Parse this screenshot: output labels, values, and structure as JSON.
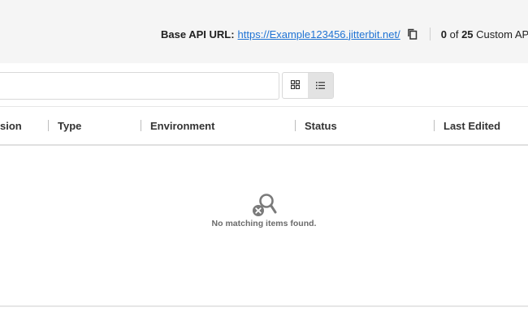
{
  "api": {
    "label": "Base API URL:",
    "url": "https://Example123456.jitterbit.net/",
    "copy_icon": "copy-icon"
  },
  "count": {
    "shown": "0",
    "of_word": "of",
    "total": "25",
    "suffix": "Custom AP"
  },
  "search": {
    "value": "",
    "placeholder": ""
  },
  "view_toggle": {
    "options": [
      "grid-view-icon",
      "list-view-icon"
    ],
    "selected": "list-view-icon"
  },
  "table": {
    "columns": [
      "sion",
      "Type",
      "Environment",
      "Status",
      "Last Edited"
    ],
    "rows": []
  },
  "empty_state": {
    "icon": "search-no-results-icon",
    "message": "No matching items found."
  },
  "colors": {
    "link": "#1f73d4",
    "topbar_bg": "#f5f5f5",
    "active_toggle_bg": "#e3e3e3"
  }
}
